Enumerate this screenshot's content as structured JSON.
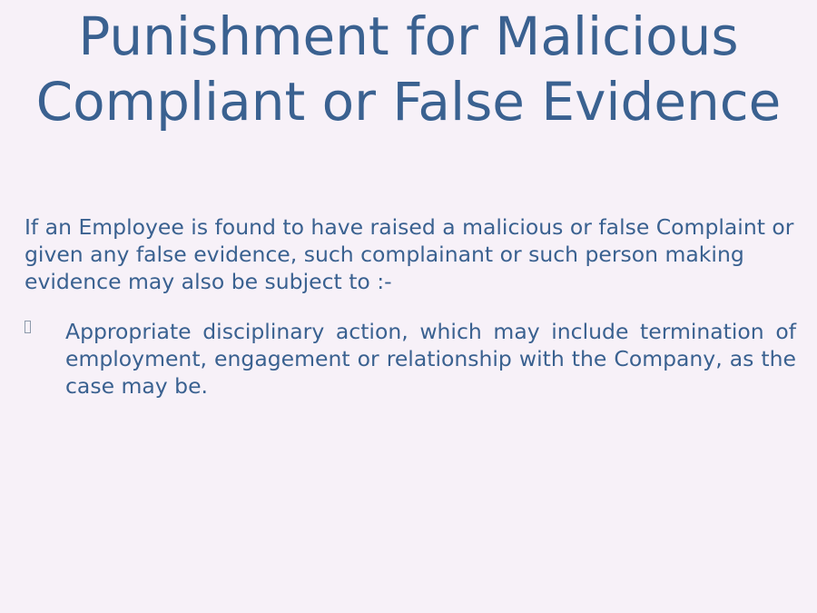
{
  "slide": {
    "title_line1": "Punishment for Malicious",
    "title_line2": "Compliant or False Evidence",
    "intro": "If an Employee is found to have raised a malicious or false Complaint or given any false evidence, such complainant or such person making evidence may also be subject to :-",
    "bullets": [
      {
        "marker_icon": "missing-glyph-icon",
        "text": "Appropriate disciplinary action, which may include termination of employment, engagement or relationship with the Company, as the case may be."
      }
    ]
  },
  "colors": {
    "background": "#f7f1f8",
    "text": "#3a6190"
  }
}
